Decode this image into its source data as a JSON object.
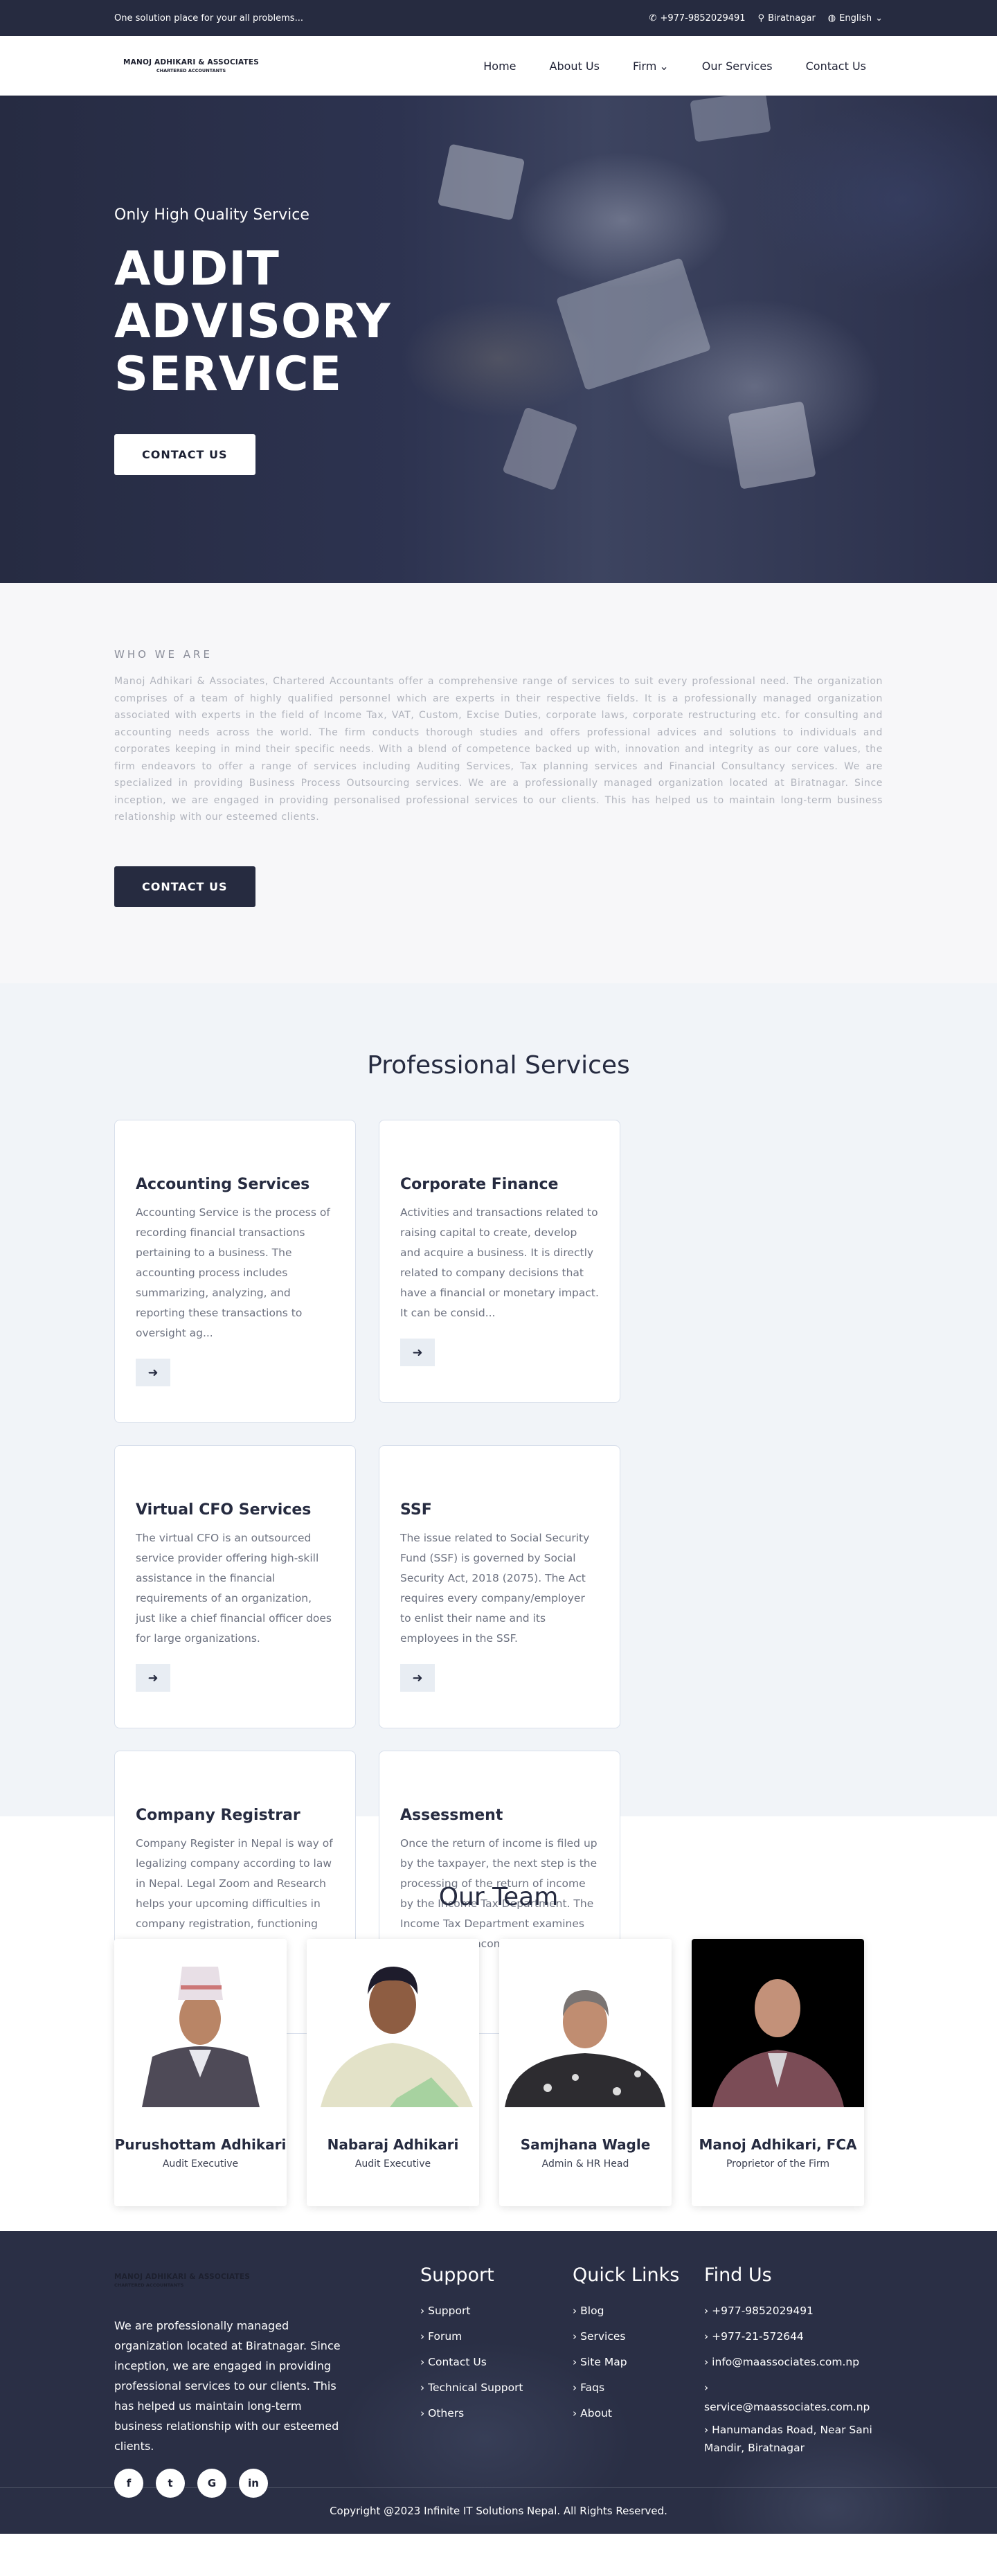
{
  "topbar": {
    "tagline": "One solution place for your all problems...",
    "phone": "+977-9852029491",
    "location": "Biratnagar",
    "language": "English"
  },
  "brand": {
    "name": "MANOJ ADHIKARI & ASSOCIATES",
    "subtitle": "CHARTERED ACCOUNTANTS"
  },
  "nav": {
    "items": [
      {
        "label": "Home"
      },
      {
        "label": "About Us"
      },
      {
        "label": "Firm"
      },
      {
        "label": "Our Services"
      },
      {
        "label": "Contact Us"
      }
    ]
  },
  "hero": {
    "subtitle": "Only High Quality Service",
    "line1": "AUDIT",
    "line2": "ADVISORY",
    "line3": "SERVICE",
    "cta": "CONTACT US"
  },
  "about": {
    "eyebrow": "WHO WE ARE",
    "text": "Manoj Adhikari & Associates, Chartered Accountants offer a comprehensive range of services to suit every professional need. The organization comprises of a team of highly qualified personnel which are experts in their respective fields. It is a professionally managed organization associated with experts in the field of Income Tax, VAT, Custom, Excise Duties, corporate laws, corporate restructuring etc. for consulting and accounting needs across the world. The firm conducts thorough studies and offers professional advices and solutions to individuals and corporates keeping in mind their specific needs. With a blend of competence backed up with, innovation and integrity as our core values, the firm endeavors to offer a range of services including Auditing Services, Tax planning services and Financial Consultancy services. We are specialized in providing Business Process Outsourcing services. We are a professionally managed organization located at Biratnagar. Since inception, we are engaged in providing personalised professional services to our clients. This has helped us to maintain long-term business relationship with our esteemed clients.",
    "cta": "CONTACT US"
  },
  "services": {
    "title": "Professional Services",
    "items": [
      {
        "title": "Accounting Services",
        "text": "Accounting Service is the process of recording financial transactions pertaining to a business. The accounting process includes summarizing, analyzing, and reporting these transactions to oversight ag..."
      },
      {
        "title": "Corporate Finance",
        "text": "Activities and transactions related to raising capital to create, develop and acquire a business. It is directly related to company decisions that have a financial or monetary impact. It can be consid..."
      },
      {
        "title": "Virtual CFO Services",
        "text": "The virtual CFO is an outsourced service provider offering high-skill assistance in the financial requirements of an organization, just like a chief financial officer does for large organizations."
      },
      {
        "title": "SSF",
        "text": "The issue related to Social Security Fund (SSF) is governed by Social Security Act, 2018 (2075). The Act requires every company/employer to enlist their name and its employees in the SSF."
      },
      {
        "title": "Company Registrar",
        "text": "Company Register in Nepal is way of legalizing company according to law in Nepal. Legal Zoom and Research helps your upcoming difficulties in company registration, functioning and operating and dissol..."
      },
      {
        "title": "Assessment",
        "text": "Once the return of income is filed up by the taxpayer, the next step is the processing of the return of income by the Income Tax Department. The Income Tax Department examines the return of income for..."
      }
    ]
  },
  "team": {
    "title": "Our Team",
    "members": [
      {
        "name": "Purushottam Adhikari",
        "role": "Audit Executive"
      },
      {
        "name": "Nabaraj Adhikari",
        "role": "Audit Executive"
      },
      {
        "name": "Samjhana Wagle",
        "role": "Admin & HR Head"
      },
      {
        "name": "Manoj Adhikari, FCA",
        "role": "Proprietor of the Firm"
      }
    ]
  },
  "footer": {
    "description": "We are professionally managed organization located at Biratnagar. Since inception, we are engaged in providing professional services to our clients. This has helped us maintain long-term business relationship with our esteemed clients.",
    "social": [
      "f",
      "t",
      "G",
      "in"
    ],
    "support": {
      "title": "Support",
      "links": [
        "Support",
        "Forum",
        "Contact Us",
        "Technical Support",
        "Others"
      ]
    },
    "quick": {
      "title": "Quick Links",
      "links": [
        "Blog",
        "Services",
        "Site Map",
        "Faqs",
        "About"
      ]
    },
    "find": {
      "title": "Find Us",
      "items": [
        "+977-9852029491",
        "+977-21-572644",
        "info@maassociates.com.np",
        "service@maassociates.com.np",
        "Hanumandas Road, Near Sani Mandir, Biratnagar"
      ]
    },
    "copyright": "Copyright @2023 Infinite IT Solutions Nepal. All Rights Reserved."
  }
}
